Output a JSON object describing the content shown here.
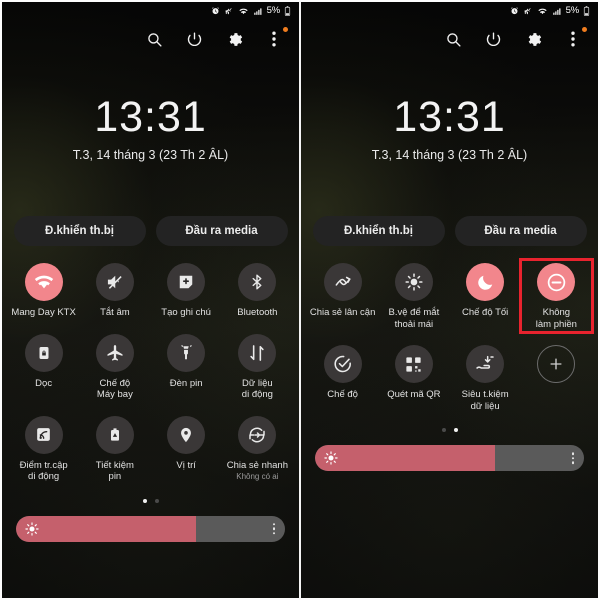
{
  "status_bar": {
    "icons": [
      "alarm-icon",
      "mute-icon",
      "wifi-icon",
      "signal-icon"
    ],
    "battery_percent": "5%",
    "battery_icon": "battery-low-icon"
  },
  "header": {
    "search_label": "search-icon",
    "power_label": "power-icon",
    "settings_label": "gear-icon",
    "more_label": "more-vertical-icon"
  },
  "clock": {
    "time": "13:31",
    "date": "T.3, 14 tháng 3 (23 Th 2 ÂL)"
  },
  "controls": {
    "device_control": "Đ.khiển th.bị",
    "media_output": "Đầu ra media"
  },
  "panels": [
    {
      "page": 1,
      "active_dot": 0,
      "tiles": [
        {
          "label": "Mang Day KTX",
          "sub": "",
          "icon": "wifi-icon",
          "active": true,
          "highlighted": false
        },
        {
          "label": "Tắt âm",
          "sub": "",
          "icon": "mute-icon",
          "active": false,
          "highlighted": false
        },
        {
          "label": "Tạo ghi chú",
          "sub": "",
          "icon": "note-add-icon",
          "active": false,
          "highlighted": false
        },
        {
          "label": "Bluetooth",
          "sub": "",
          "icon": "bluetooth-icon",
          "active": false,
          "highlighted": false
        },
        {
          "label": "Dọc",
          "sub": "",
          "icon": "rotation-lock-icon",
          "active": false,
          "highlighted": false
        },
        {
          "label": "Chế độ\nMáy bay",
          "sub": "",
          "icon": "airplane-icon",
          "active": false,
          "highlighted": false
        },
        {
          "label": "Đèn pin",
          "sub": "",
          "icon": "flashlight-icon",
          "active": false,
          "highlighted": false
        },
        {
          "label": "Dữ liệu\ndi động",
          "sub": "",
          "icon": "mobile-data-icon",
          "active": false,
          "highlighted": false
        },
        {
          "label": "Điểm tr.cập\ndi động",
          "sub": "",
          "icon": "hotspot-icon",
          "active": false,
          "highlighted": false
        },
        {
          "label": "Tiết kiệm\npin",
          "sub": "",
          "icon": "battery-saver-icon",
          "active": false,
          "highlighted": false
        },
        {
          "label": "Vị trí",
          "sub": "",
          "icon": "location-pin-icon",
          "active": false,
          "highlighted": false
        },
        {
          "label": "Chia sẻ nhanh",
          "sub": "Không có ai",
          "icon": "quick-share-icon",
          "active": false,
          "highlighted": false
        }
      ]
    },
    {
      "page": 2,
      "active_dot": 1,
      "tiles": [
        {
          "label": "Chia sẻ lân cận",
          "sub": "",
          "icon": "nearby-share-icon",
          "active": false,
          "highlighted": false
        },
        {
          "label": "B.vệ để mắt\nthoải mái",
          "sub": "",
          "icon": "eye-comfort-icon",
          "active": false,
          "highlighted": false
        },
        {
          "label": "Chế độ Tối",
          "sub": "",
          "icon": "dark-mode-moon-icon",
          "active": true,
          "highlighted": false
        },
        {
          "label": "Không\nlàm phiền",
          "sub": "",
          "icon": "do-not-disturb-icon",
          "active": true,
          "highlighted": true
        },
        {
          "label": "Chế độ",
          "sub": "",
          "icon": "modes-check-icon",
          "active": false,
          "highlighted": false
        },
        {
          "label": "Quét mã QR",
          "sub": "",
          "icon": "qr-code-icon",
          "active": false,
          "highlighted": false
        },
        {
          "label": "Siêu t.kiệm\ndữ liệu",
          "sub": "",
          "icon": "ultra-data-saving-icon",
          "active": false,
          "highlighted": false
        },
        {
          "label": "",
          "sub": "",
          "icon": "add-tile-icon",
          "active": false,
          "highlighted": false,
          "add": true
        }
      ]
    }
  ],
  "brightness": {
    "percent": 67,
    "icon": "brightness-sun-icon",
    "menu_icon": "more-vertical-icon"
  },
  "colors": {
    "accent_active": "#f2868c",
    "slider_fill": "#c5606c",
    "highlight_box": "#e8232e",
    "tile_bg": "#3a3737",
    "pill_bg": "#232323",
    "notification_dot": "#f07d1f"
  }
}
